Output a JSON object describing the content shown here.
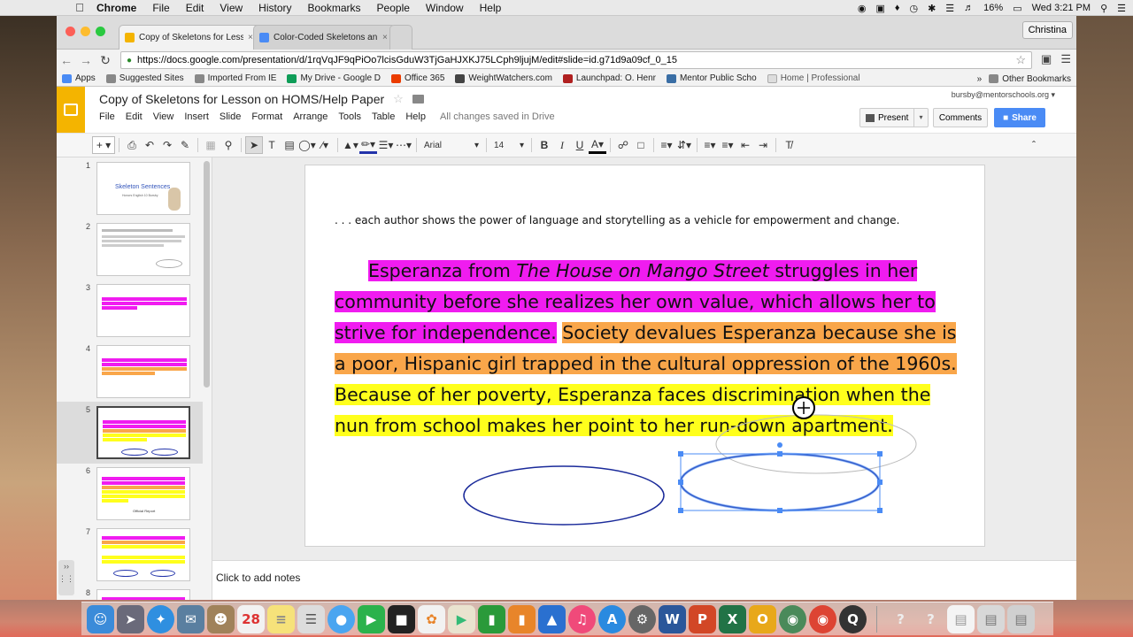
{
  "mac_menubar": {
    "app": "Chrome",
    "items": [
      "File",
      "Edit",
      "View",
      "History",
      "Bookmarks",
      "People",
      "Window",
      "Help"
    ],
    "battery": "16%",
    "clock": "Wed 3:21 PM"
  },
  "browser": {
    "tabs": [
      {
        "label": "Copy of Skeletons for Less",
        "close": "×",
        "color": "#f4b400"
      },
      {
        "label": "Color-Coded Skeletons an",
        "close": "×",
        "color": "#4a8bf5"
      }
    ],
    "profile": "Christina",
    "url": "https://docs.google.com/presentation/d/1rqVqJF9qPiOo7lcisGduW3TjGaHJXKJ75LCph9ljujM/edit#slide=id.g71d9a09cf_0_15",
    "bookmarks": [
      {
        "label": "Apps",
        "color": "#4a8bf5"
      },
      {
        "label": "Suggested Sites",
        "color": "#888888"
      },
      {
        "label": "Imported From IE",
        "color": "#888888"
      },
      {
        "label": "My Drive - Google D",
        "color": "#0f9d58"
      },
      {
        "label": "Office 365",
        "color": "#eb3c00"
      },
      {
        "label": "WeightWatchers.com",
        "color": "#444444"
      },
      {
        "label": "Launchpad: O. Henr",
        "color": "#b02020"
      },
      {
        "label": "Mentor Public Scho",
        "color": "#3a6ea5"
      },
      {
        "label": "Home | Professional",
        "color": "#cccccc"
      }
    ],
    "bookmarks_more": "»",
    "other_bookmarks": "Other Bookmarks"
  },
  "doc": {
    "title": "Copy of Skeletons for Lesson on HOMS/Help Paper",
    "menus": [
      "File",
      "Edit",
      "View",
      "Insert",
      "Slide",
      "Format",
      "Arrange",
      "Tools",
      "Table",
      "Help"
    ],
    "save_status": "All changes saved in Drive",
    "user_email": "bursby@mentorschools.org",
    "present_label": "Present",
    "comments_label": "Comments",
    "share_label": "Share"
  },
  "toolbar": {
    "font": "Arial",
    "font_size": "14"
  },
  "slides": [
    {
      "num": "1",
      "title": "Skeleton Sentences",
      "subtitle": "Honors English 10 Bursby"
    },
    {
      "num": "2"
    },
    {
      "num": "3"
    },
    {
      "num": "4"
    },
    {
      "num": "5"
    },
    {
      "num": "6",
      "caption": "Official Report"
    },
    {
      "num": "7"
    },
    {
      "num": "8"
    }
  ],
  "selected_slide": 5,
  "slide": {
    "intro": ". . . each author shows the power of language and storytelling as a vehicle for empowerment and change.",
    "p1a": "Esperanza from ",
    "p1b": "The House on Mango Street",
    "p1c": " struggles in her community before she realizes her own value, which allows her to strive for independence.",
    "p2": "Society devalues Esperanza because she is a poor, Hispanic girl trapped in the cultural oppression of the 1960s.",
    "p3": "Because of her poverty, Esperanza faces discrimination when the nun from school makes her point to her run-down apartment.",
    "highlight_colors": {
      "magenta": "#f01cf0",
      "orange": "#f9a64a",
      "yellow": "#ffff1c"
    }
  },
  "notes_placeholder": "Click to add notes"
}
